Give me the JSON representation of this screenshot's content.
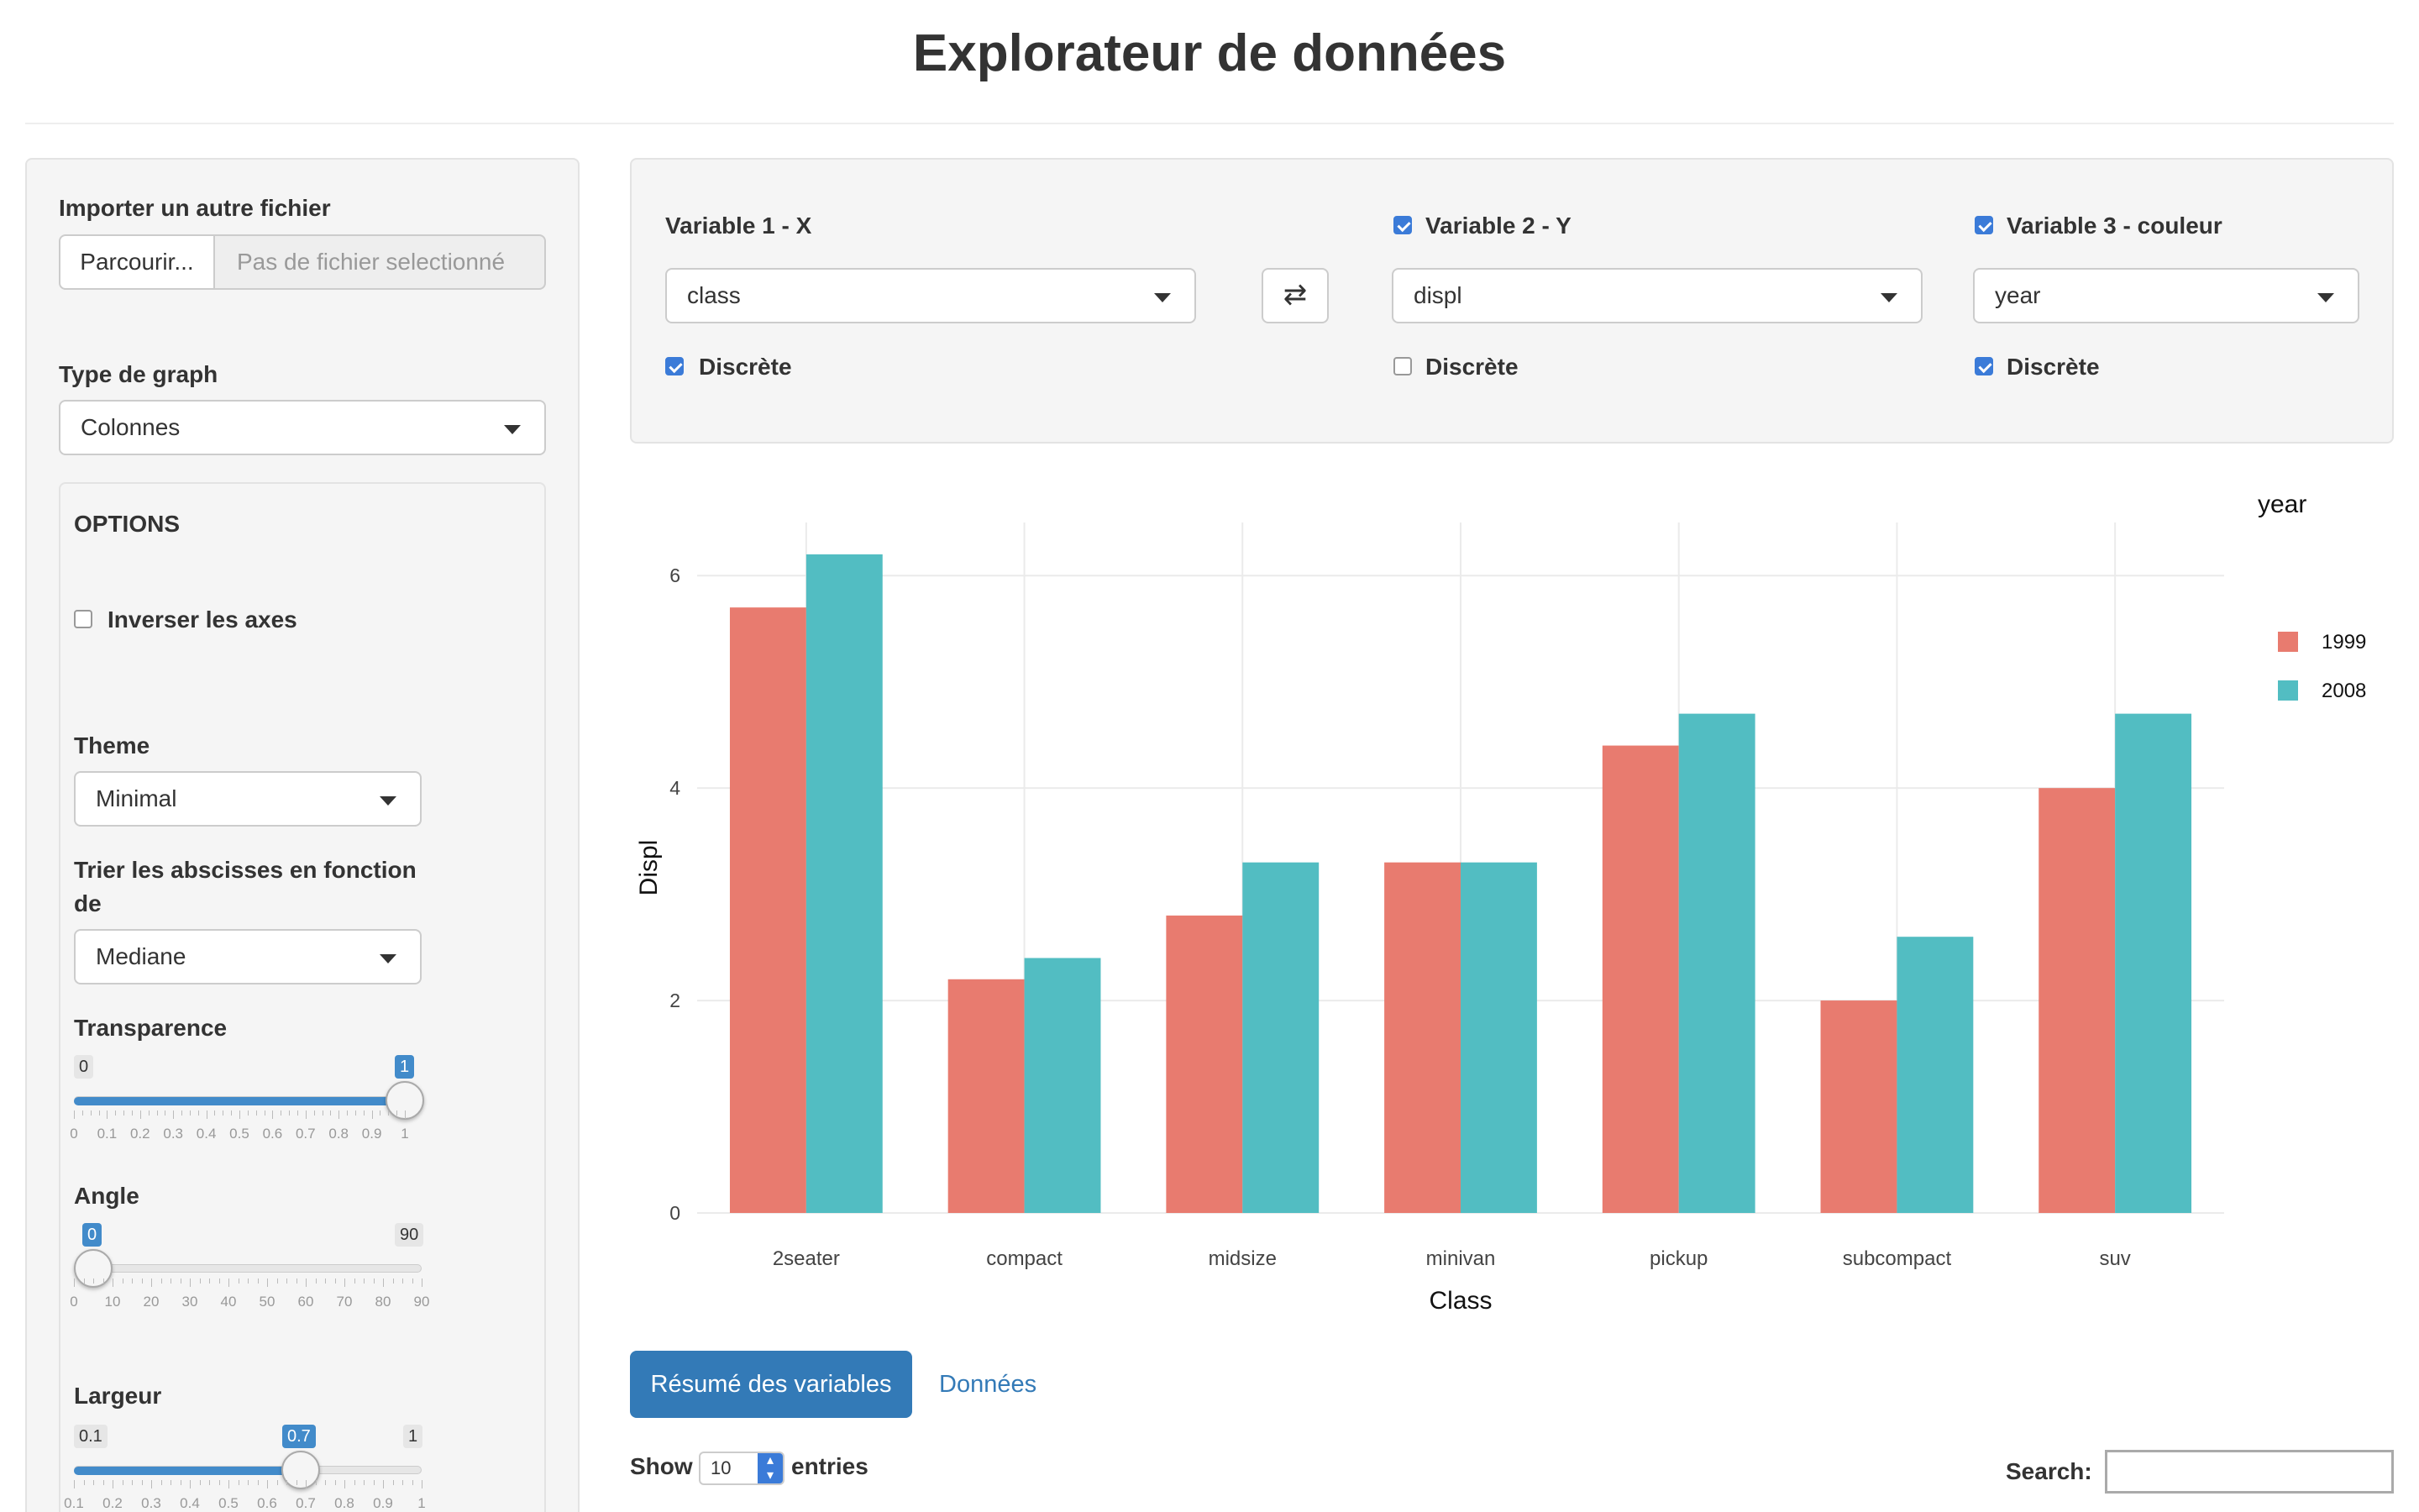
{
  "header": {
    "title": "Explorateur de données"
  },
  "sidebar": {
    "import_label": "Importer un autre fichier",
    "browse_label": "Parcourir...",
    "file_placeholder": "Pas de fichier selectionné",
    "graph_type_label": "Type de graph",
    "graph_type_value": "Colonnes",
    "options": {
      "title": "OPTIONS",
      "invert_axes_label": "Inverser les axes",
      "invert_axes_checked": false,
      "theme_label": "Theme",
      "theme_value": "Minimal",
      "sort_label_line1": "Trier les abscisses en fonction",
      "sort_label_line2": "de",
      "sort_value": "Mediane",
      "transparence": {
        "label": "Transparence",
        "min": "0",
        "max": "1",
        "value": "1",
        "ticks": [
          "0",
          "0.1",
          "0.2",
          "0.3",
          "0.4",
          "0.5",
          "0.6",
          "0.7",
          "0.8",
          "0.9",
          "1"
        ]
      },
      "angle": {
        "label": "Angle",
        "min": "0",
        "max": "90",
        "value": "0",
        "ticks": [
          "0",
          "10",
          "20",
          "30",
          "40",
          "50",
          "60",
          "70",
          "80",
          "90"
        ]
      },
      "largeur": {
        "label": "Largeur",
        "min": "0.1",
        "max": "1",
        "value": "0.7",
        "ticks": [
          "0.1",
          "0.2",
          "0.3",
          "0.4",
          "0.5",
          "0.6",
          "0.7",
          "0.8",
          "0.9",
          "1"
        ]
      }
    }
  },
  "variables": {
    "var1": {
      "label": "Variable 1 - X",
      "value": "class",
      "discrete_label": "Discrète",
      "discrete": true
    },
    "swap_icon": "⇄",
    "var2": {
      "label": "Variable 2 - Y",
      "value": "displ",
      "enabled": true,
      "discrete_label": "Discrète",
      "discrete": false
    },
    "var3": {
      "label": "Variable 3 - couleur",
      "value": "year",
      "enabled": true,
      "discrete_label": "Discrète",
      "discrete": true
    }
  },
  "chart_data": {
    "type": "bar",
    "categories": [
      "2seater",
      "compact",
      "midsize",
      "minivan",
      "pickup",
      "subcompact",
      "suv"
    ],
    "series": [
      {
        "name": "1999",
        "color": "#e87b6f",
        "values": [
          5.7,
          2.2,
          2.8,
          3.3,
          4.4,
          2.0,
          4.0
        ]
      },
      {
        "name": "2008",
        "color": "#52bdc2",
        "values": [
          6.2,
          2.4,
          3.3,
          3.3,
          4.7,
          2.6,
          4.7
        ]
      }
    ],
    "xlabel": "Class",
    "ylabel": "Displ",
    "ylim": [
      0,
      6.5
    ],
    "yticks": [
      "0",
      "2",
      "4",
      "6"
    ],
    "legend_title": "year",
    "legend_position": "right",
    "grid": true
  },
  "tabs": [
    {
      "label": "Résumé des variables",
      "active": true
    },
    {
      "label": "Données",
      "active": false
    }
  ],
  "table_controls": {
    "show_label": "Show",
    "entries_value": "10",
    "entries_label": "entries",
    "search_label": "Search:"
  }
}
